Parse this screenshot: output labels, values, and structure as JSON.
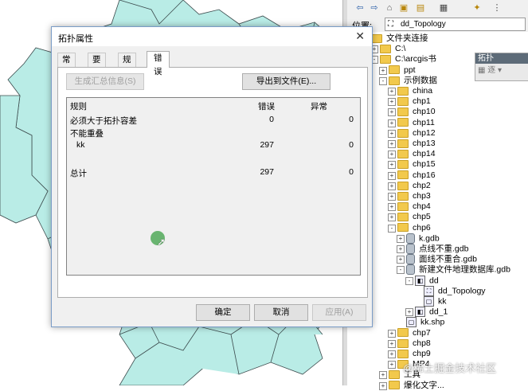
{
  "colors": {
    "map_fill": "#b9ece6",
    "map_stroke": "#3c4b4d",
    "folder": "#f2c94c",
    "active_tab": "#ffffff"
  },
  "catalog": {
    "toolbar_icons": [
      "back-arrow-icon",
      "forward-arrow-icon",
      "home-icon",
      "up-folder-icon",
      "connect-folder-icon",
      "grid-view-icon",
      "new-icon",
      "more-icon"
    ],
    "location_label": "位置:",
    "location_value": "dd_Topology",
    "tree": [
      {
        "label": "文件夹连接",
        "icon": "folder-connections-icon",
        "exp": "-",
        "indent": 0
      },
      {
        "label": "C:\\",
        "icon": "folder-icon",
        "exp": "+",
        "indent": 1
      },
      {
        "label": "C:\\arcgis书",
        "icon": "folder-icon",
        "exp": "-",
        "indent": 1
      },
      {
        "label": "ppt",
        "icon": "folder-icon",
        "exp": "+",
        "indent": 2
      },
      {
        "label": "示例数据",
        "icon": "folder-icon",
        "exp": "-",
        "indent": 2
      },
      {
        "label": "china",
        "icon": "folder-icon",
        "exp": "+",
        "indent": 3
      },
      {
        "label": "chp1",
        "icon": "folder-icon",
        "exp": "+",
        "indent": 3
      },
      {
        "label": "chp10",
        "icon": "folder-icon",
        "exp": "+",
        "indent": 3
      },
      {
        "label": "chp11",
        "icon": "folder-icon",
        "exp": "+",
        "indent": 3
      },
      {
        "label": "chp12",
        "icon": "folder-icon",
        "exp": "+",
        "indent": 3
      },
      {
        "label": "chp13",
        "icon": "folder-icon",
        "exp": "+",
        "indent": 3
      },
      {
        "label": "chp14",
        "icon": "folder-icon",
        "exp": "+",
        "indent": 3
      },
      {
        "label": "chp15",
        "icon": "folder-icon",
        "exp": "+",
        "indent": 3
      },
      {
        "label": "chp16",
        "icon": "folder-icon",
        "exp": "+",
        "indent": 3
      },
      {
        "label": "chp2",
        "icon": "folder-icon",
        "exp": "+",
        "indent": 3
      },
      {
        "label": "chp3",
        "icon": "folder-icon",
        "exp": "+",
        "indent": 3
      },
      {
        "label": "chp4",
        "icon": "folder-icon",
        "exp": "+",
        "indent": 3
      },
      {
        "label": "chp5",
        "icon": "folder-icon",
        "exp": "+",
        "indent": 3
      },
      {
        "label": "chp6",
        "icon": "folder-icon",
        "exp": "-",
        "indent": 3
      },
      {
        "label": "k.gdb",
        "icon": "gdb-icon",
        "exp": "+",
        "indent": 4
      },
      {
        "label": "点线不重.gdb",
        "icon": "gdb-icon",
        "exp": "+",
        "indent": 4
      },
      {
        "label": "面线不重合.gdb",
        "icon": "gdb-icon",
        "exp": "+",
        "indent": 4
      },
      {
        "label": "新建文件地理数据库.gdb",
        "icon": "gdb-icon",
        "exp": "-",
        "indent": 4
      },
      {
        "label": "dd",
        "icon": "feature-dataset-icon",
        "exp": "-",
        "indent": 5
      },
      {
        "label": "dd_Topology",
        "icon": "topology-icon",
        "exp": "",
        "indent": 6
      },
      {
        "label": "kk",
        "icon": "feature-class-icon",
        "exp": "",
        "indent": 6
      },
      {
        "label": "dd_1",
        "icon": "feature-dataset-icon",
        "exp": "+",
        "indent": 5
      },
      {
        "label": "kk.shp",
        "icon": "shapefile-icon",
        "exp": "",
        "indent": 4
      },
      {
        "label": "chp7",
        "icon": "folder-icon",
        "exp": "+",
        "indent": 3
      },
      {
        "label": "chp8",
        "icon": "folder-icon",
        "exp": "+",
        "indent": 3
      },
      {
        "label": "chp9",
        "icon": "folder-icon",
        "exp": "+",
        "indent": 3
      },
      {
        "label": "MP4",
        "icon": "folder-icon",
        "exp": "+",
        "indent": 3
      },
      {
        "label": "工具",
        "icon": "folder-icon",
        "exp": "+",
        "indent": 2
      },
      {
        "label": "爆化文字...",
        "icon": "folder-icon",
        "exp": "+",
        "indent": 2
      }
    ],
    "popup": {
      "title": "拓扑",
      "body": "▦ 逐 ▾"
    },
    "watermark": "@稀土掘金技术社区"
  },
  "dialog": {
    "title": "拓扑属性",
    "tabs": [
      "常规",
      "要素类",
      "规则",
      "错误"
    ],
    "active_tab": "错误",
    "generate_summary_button": "生成汇总信息(S)",
    "export_button": "导出到文件(E)...",
    "table": {
      "headers": [
        "规则",
        "错误",
        "异常"
      ],
      "rows": [
        {
          "rule": "必须大于拓扑容差",
          "errors": "0",
          "exceptions": "0"
        },
        {
          "rule": "不能重叠",
          "errors": "",
          "exceptions": ""
        },
        {
          "rule": "kk",
          "errors": "297",
          "exceptions": "0"
        },
        {
          "rule": "",
          "errors": "",
          "exceptions": ""
        },
        {
          "rule": "总计",
          "errors": "297",
          "exceptions": "0"
        }
      ]
    },
    "buttons": {
      "ok": "确定",
      "cancel": "取消",
      "apply": "应用(A)"
    }
  }
}
